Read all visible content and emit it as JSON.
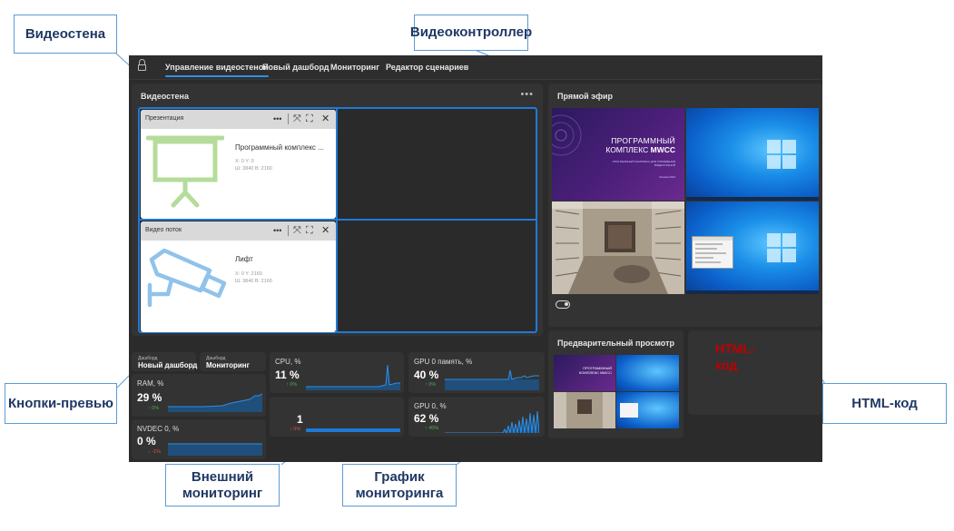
{
  "callouts": {
    "videowall": "Видеостена",
    "videocontroller": "Видеоконтроллер",
    "preview_buttons": "Кнопки-превью",
    "html_code": "HTML-код",
    "external_monitoring_l1": "Внешний",
    "external_monitoring_l2": "мониторинг",
    "monitoring_chart_l1": "График",
    "monitoring_chart_l2": "мониторинга"
  },
  "nav": {
    "tabs": [
      "Управление видеостеной",
      "Новый дашборд",
      "Мониторинг",
      "Редактор сценариев"
    ],
    "active_index": 0
  },
  "videowall": {
    "title": "Видеостена",
    "menu": "•••",
    "cards": [
      {
        "type": "Презентация",
        "name": "Программный комплекс ...",
        "pos": "X: 0 Y: 0",
        "size": "Ш: 3840 В: 2160",
        "icon": "presentation-board-icon"
      },
      {
        "type": "Видео поток",
        "name": "Лифт",
        "pos": "X: 0 Y: 2160",
        "size": "Ш: 3840 В: 2160",
        "icon": "cctv-camera-icon"
      }
    ],
    "controls": [
      "•••",
      "⤧",
      "⛶",
      "✕"
    ]
  },
  "live": {
    "title": "Прямой эфир",
    "slide_line1": "ПРОГРАММНЫЙ",
    "slide_line2a": "КОМПЛЕКС ",
    "slide_line2b": "MWCC",
    "slide_sub": "ПРОГРАММНЫЙ КОМПЛЕКС ДЛЯ УПРАВЛЕНИЯ ВИДЕОСТЕНОЙ",
    "slide_footer": "Москва 2023"
  },
  "preview": {
    "title": "Предварительный просмотр",
    "slide_line1": "ПРОГРАММНЫЙ",
    "slide_line2": "КОМПЛЕКС MWCC"
  },
  "html_widget": {
    "text_line1": "HTML-",
    "text_line2": "код"
  },
  "presets": [
    {
      "small": "Дашборд",
      "name": "Новый дашборд"
    },
    {
      "small": "Дашборд",
      "name": "Мониторинг"
    }
  ],
  "metrics": {
    "ram": {
      "label": "RAM, %",
      "value": "29 %",
      "delta": "↑ 0%",
      "trend": "up"
    },
    "nvdec": {
      "label": "NVDEC 0, %",
      "value": "0 %",
      "delta": "↓ -1%",
      "trend": "down"
    },
    "cpu": {
      "label": "CPU, %",
      "value": "11 %",
      "delta": "↑ 0%",
      "trend": "up"
    },
    "external": {
      "label": "",
      "value": "1",
      "delta": "↓ 0%",
      "trend": "down"
    },
    "gpu_mem": {
      "label": "GPU 0 память, %",
      "value": "40 %",
      "delta": "↑ 0%",
      "trend": "up"
    },
    "gpu": {
      "label": "GPU 0, %",
      "value": "62 %",
      "delta": "↑ 40%",
      "trend": "up"
    }
  },
  "colors": {
    "accent": "#1e7ad6",
    "up": "#4caf50",
    "down": "#e05050",
    "html_red": "#c00000",
    "callout": "#5b9bd5"
  }
}
